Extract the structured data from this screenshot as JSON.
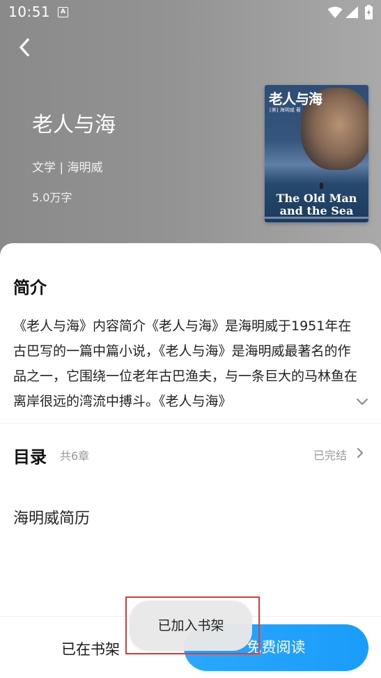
{
  "status_bar": {
    "time": "10:51",
    "notification_icon": "A"
  },
  "book": {
    "title": "老人与海",
    "meta": "文学 | 海明威",
    "word_count": "5.0万字",
    "cover": {
      "title_cn": "老人与海",
      "subtitle": "[美] 海明威 著",
      "title_en_line1": "The Old Man",
      "title_en_line2": "and the Sea"
    }
  },
  "intro": {
    "title": "简介",
    "text": "《老人与海》内容简介《老人与海》是海明威于1951年在古巴写的一篇中篇小说，《老人与海》是海明威最著名的作品之一，它围绕一位老年古巴渔夫，与一条巨大的马林鱼在离岸很远的湾流中搏斗。《老人与海》"
  },
  "toc": {
    "title": "目录",
    "count": "共6章",
    "status": "已完结",
    "first_chapter": "海明威简历"
  },
  "bottom_bar": {
    "shelf_label": "已在书架",
    "read_label": "免费阅读"
  },
  "toast": {
    "message": "已加入书架"
  },
  "colors": {
    "accent": "#1a9cfa",
    "highlight": "#e53935",
    "hero_gradient_start": "#8a8a8a",
    "hero_gradient_end": "#a9a9a9"
  }
}
